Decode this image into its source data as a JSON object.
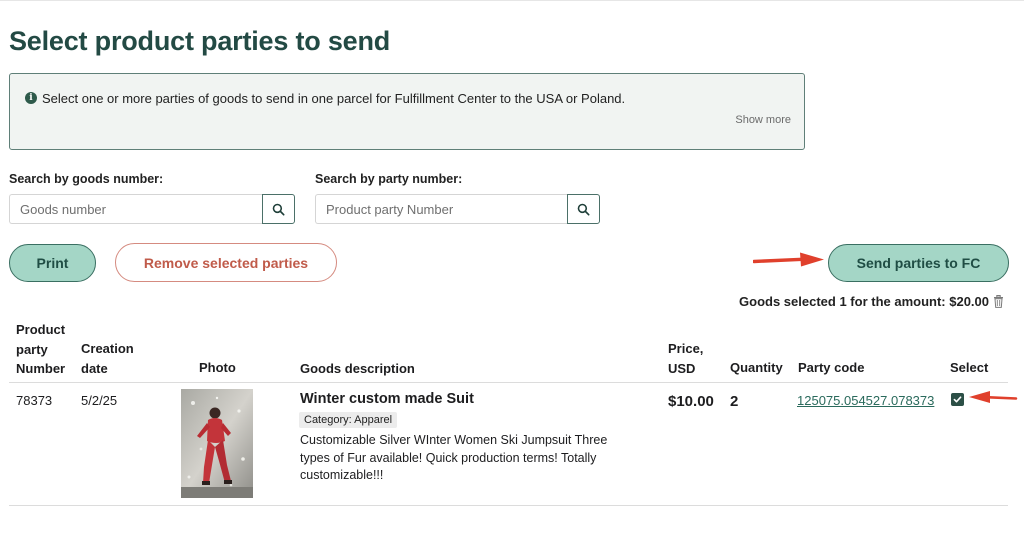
{
  "page": {
    "title": "Select product parties to send"
  },
  "info": {
    "icon": "info-icon",
    "text": "Select one or more parties of goods to send in one parcel for Fulfillment Center to the USA or Poland.",
    "show_more": "Show more"
  },
  "search": {
    "goods_label": "Search by goods number:",
    "goods_placeholder": "Goods number",
    "party_label": "Search by party number:",
    "party_placeholder": "Product party Number"
  },
  "actions": {
    "print": "Print",
    "remove": "Remove selected parties",
    "send": "Send parties to FC"
  },
  "summary": {
    "text": "Goods selected 1 for the amount: $20.00"
  },
  "table": {
    "headers": {
      "party_number": [
        "Product",
        "party",
        "Number"
      ],
      "creation_date": [
        "Creation",
        "date"
      ],
      "photo": "Photo",
      "description": "Goods description",
      "price": [
        "Price,",
        "USD"
      ],
      "quantity": "Quantity",
      "party_code": "Party code",
      "select": "Select"
    },
    "rows": [
      {
        "party_number": "78373",
        "creation_date": "5/2/25",
        "title": "Winter custom made Suit",
        "category": "Category: Apparel",
        "description": "Customizable Silver WInter Women Ski Jumpsuit Three types of Fur available! Quick production terms! Totally customizable!!!",
        "price": "$10.00",
        "quantity": "2",
        "party_code": "125075.054527.078373",
        "selected": true
      }
    ]
  },
  "colors": {
    "accent": "#a4d6c6",
    "accent_border": "#3a6f62",
    "title": "#234a44",
    "danger": "#c05b4a",
    "arrow": "#e0402c"
  }
}
